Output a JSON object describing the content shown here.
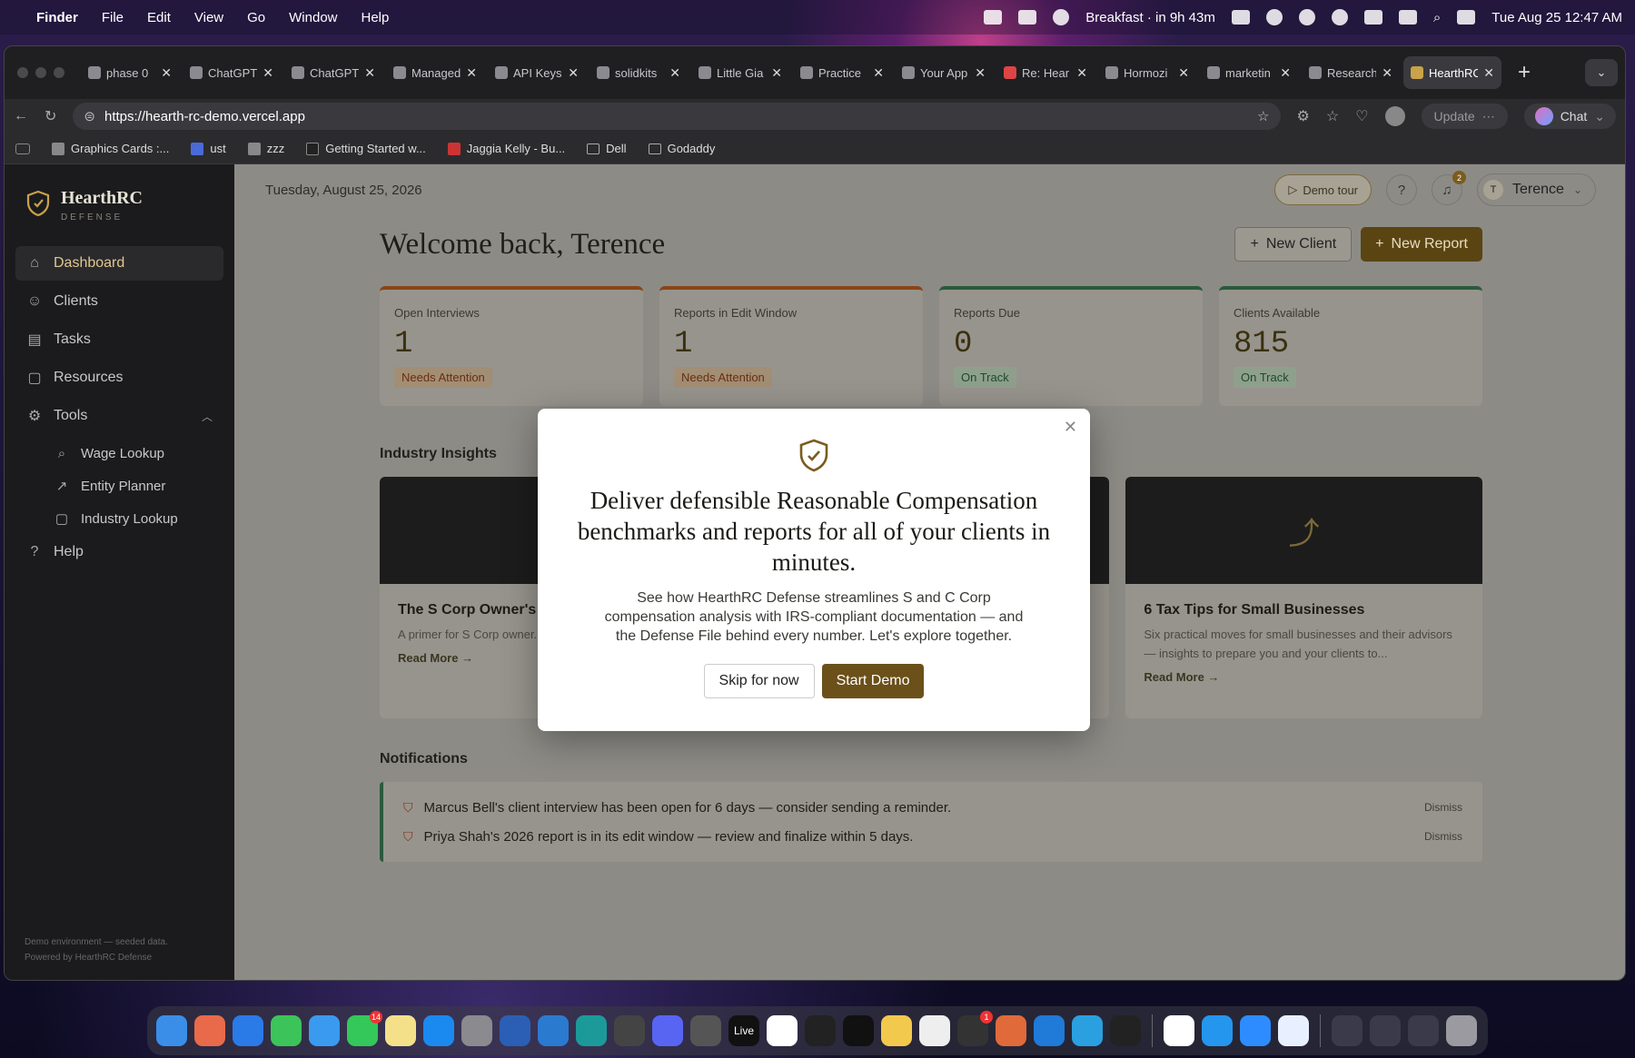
{
  "menubar": {
    "app": "Finder",
    "items": [
      "File",
      "Edit",
      "View",
      "Go",
      "Window",
      "Help"
    ],
    "event": "Breakfast · in 9h 43m",
    "datetime": "Tue Aug 25  12:47 AM"
  },
  "browser": {
    "tabs": [
      {
        "title": "phase 0",
        "active": false
      },
      {
        "title": "ChatGPT",
        "active": false
      },
      {
        "title": "ChatGPT",
        "active": true
      },
      {
        "title": "Managed",
        "active": false
      },
      {
        "title": "API Keys",
        "active": false
      },
      {
        "title": "solidkits",
        "active": false
      },
      {
        "title": "Little Gia",
        "active": false
      },
      {
        "title": "Practice",
        "active": false
      },
      {
        "title": "Your App",
        "active": false
      },
      {
        "title": "Re: Hear",
        "active": false
      },
      {
        "title": "Hormozi",
        "active": false
      },
      {
        "title": "marketin",
        "active": false
      },
      {
        "title": "Research",
        "active": false
      },
      {
        "title": "HearthRC",
        "active": true
      }
    ],
    "url": "https://hearth-rc-demo.vercel.app",
    "update_label": "Update",
    "chat_label": "Chat",
    "bookmarks": [
      "Graphics Cards :...",
      "ust",
      "zzz",
      "Getting Started w...",
      "Jaggia Kelly - Bu...",
      "Dell",
      "Godaddy"
    ]
  },
  "sidebar": {
    "brand": "HearthRC",
    "brand_sub": "DEFENSE",
    "nav": [
      {
        "label": "Dashboard",
        "icon": "home-icon"
      },
      {
        "label": "Clients",
        "icon": "users-icon"
      },
      {
        "label": "Tasks",
        "icon": "clipboard-icon"
      },
      {
        "label": "Resources",
        "icon": "book-icon"
      },
      {
        "label": "Tools",
        "icon": "gear-icon"
      }
    ],
    "tools": [
      {
        "label": "Wage Lookup",
        "icon": "search-icon"
      },
      {
        "label": "Entity Planner",
        "icon": "trend-icon"
      },
      {
        "label": "Industry Lookup",
        "icon": "book-icon"
      }
    ],
    "help": "Help",
    "footer_line1": "Demo environment — seeded data.",
    "footer_line2": "Powered by HearthRC Defense"
  },
  "header": {
    "date": "Tuesday, August 25, 2026",
    "demo_tour": "Demo tour",
    "help": "?",
    "notif_count": "2",
    "user_initial": "T",
    "user_name": "Terence"
  },
  "dashboard": {
    "welcome": "Welcome back, Terence",
    "new_client": "New Client",
    "new_report": "New Report",
    "stats": [
      {
        "label": "Open Interviews",
        "value": "1",
        "status": "Needs Attention"
      },
      {
        "label": "Reports in Edit Window",
        "value": "1",
        "status": "Needs Attention"
      },
      {
        "label": "Reports Due",
        "value": "0",
        "status": "On Track"
      },
      {
        "label": "Clients Available",
        "value": "815",
        "status": "On Track"
      }
    ],
    "insights_title": "Industry Insights",
    "insights": [
      {
        "title": "The S Corp Owner's G... Compensation",
        "desc": "A primer for S Corp owner... compensation is, why it's ...",
        "more": "Read More →"
      },
      {
        "title": "",
        "desc": "",
        "more": ""
      },
      {
        "title": "6 Tax Tips for Small Businesses",
        "desc": "Six practical moves for small businesses and their advisors — insights to prepare you and your clients to...",
        "more": "Read More →"
      }
    ],
    "notifications_title": "Notifications",
    "notifications": [
      {
        "text": "Marcus Bell's client interview has been open for 6 days — consider sending a reminder.",
        "action": "Dismiss"
      },
      {
        "text": "Priya Shah's 2026 report is in its edit window — review and finalize within 5 days.",
        "action": "Dismiss"
      }
    ]
  },
  "modal": {
    "title": "Deliver defensible Reasonable Compensation benchmarks and reports for all of your clients in minutes.",
    "body": "See how HearthRC Defense streamlines S and C Corp compensation analysis with IRS-compliant documentation — and the Defense File behind every number. Let's explore together.",
    "skip": "Skip for now",
    "start": "Start Demo"
  },
  "dock": {
    "badges": {
      "messages": "14",
      "chatgpt": "1"
    },
    "live_label": "Live"
  },
  "colors": {
    "accent": "#5a4512",
    "attention": "#8a4516",
    "on_track": "#2a5a3c",
    "sidebar_bg": "#1b1b1d"
  }
}
